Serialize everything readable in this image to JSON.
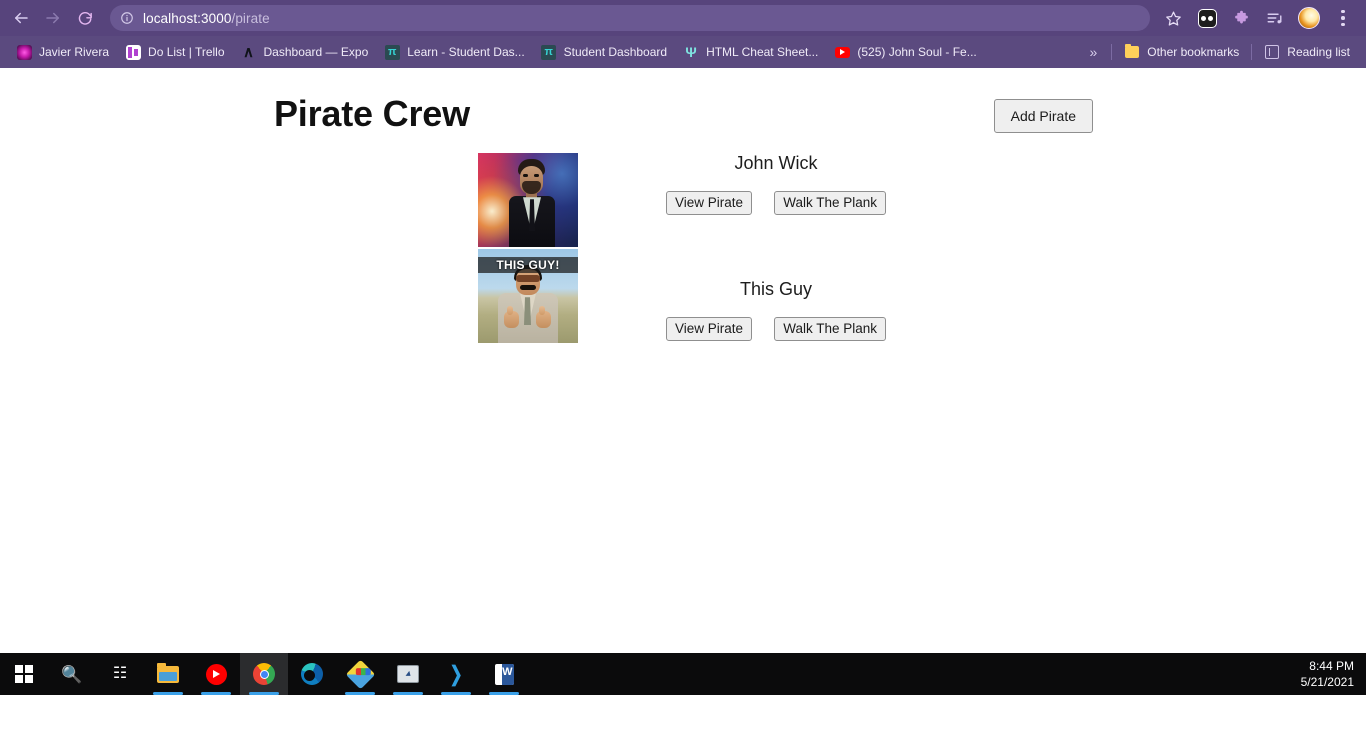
{
  "browser": {
    "back_icon": "back-arrow-icon",
    "forward_icon": "forward-arrow-icon",
    "reload_icon": "reload-icon",
    "omnibox": {
      "info_icon": "site-info-icon",
      "host": "localhost:3000",
      "path": "/pirate",
      "full_url": "localhost:3000/pirate"
    },
    "actions": [
      {
        "name": "bookmark-star-icon",
        "label": ""
      },
      {
        "name": "extension-robot-icon",
        "label": ""
      },
      {
        "name": "extensions-puzzle-icon",
        "label": ""
      },
      {
        "name": "reading-playlist-icon",
        "label": ""
      },
      {
        "name": "profile-avatar-icon",
        "label": ""
      },
      {
        "name": "chrome-menu-icon",
        "label": ""
      }
    ],
    "bookmarks": [
      {
        "label": "Javier Rivera",
        "icon": "javier-rivera-favicon"
      },
      {
        "label": "Do List | Trello",
        "icon": "trello-favicon"
      },
      {
        "label": "Dashboard — Expo",
        "icon": "expo-favicon"
      },
      {
        "label": "Learn - Student Das...",
        "icon": "learn-favicon"
      },
      {
        "label": "Student Dashboard",
        "icon": "student-dashboard-favicon"
      },
      {
        "label": "HTML Cheat Sheet...",
        "icon": "html-cheatsheet-favicon"
      },
      {
        "label": "(525) John Soul - Fe...",
        "icon": "youtube-favicon"
      }
    ],
    "overflow_label": "»",
    "other_bookmarks": {
      "label": "Other bookmarks",
      "icon": "folder-icon"
    },
    "reading_list": {
      "label": "Reading list",
      "icon": "reading-list-icon"
    }
  },
  "page": {
    "title": "Pirate Crew",
    "add_button": "Add Pirate",
    "pirates": [
      {
        "name": "John Wick",
        "image_alt": "john-wick-photo",
        "image_caption": "",
        "view_label": "View Pirate",
        "plank_label": "Walk The Plank"
      },
      {
        "name": "This Guy",
        "image_alt": "this-guy-photo",
        "image_caption": "THIS GUY!",
        "view_label": "View Pirate",
        "plank_label": "Walk The Plank"
      }
    ]
  },
  "taskbar": {
    "items": [
      {
        "name": "start-button",
        "icon": "windows-start-icon",
        "state": "idle"
      },
      {
        "name": "search-button",
        "icon": "search-icon",
        "state": "idle"
      },
      {
        "name": "task-view-button",
        "icon": "task-view-icon",
        "state": "idle"
      },
      {
        "name": "file-explorer-button",
        "icon": "file-explorer-icon",
        "state": "open"
      },
      {
        "name": "youtube-music-button",
        "icon": "youtube-music-icon",
        "state": "open"
      },
      {
        "name": "chrome-button",
        "icon": "chrome-icon",
        "state": "active"
      },
      {
        "name": "edge-button",
        "icon": "edge-icon",
        "state": "idle"
      },
      {
        "name": "paint-button",
        "icon": "paint-icon",
        "state": "open"
      },
      {
        "name": "monitor-button",
        "icon": "system-monitor-icon",
        "state": "open"
      },
      {
        "name": "vscode-button",
        "icon": "vscode-icon",
        "state": "open"
      },
      {
        "name": "word-button",
        "icon": "word-icon",
        "state": "open"
      }
    ],
    "clock": {
      "time": "8:44 PM",
      "date": "5/21/2021"
    }
  },
  "colors": {
    "chrome_toolbar": "#57447c",
    "chrome_bookmarks_bar": "#5b4a7f",
    "omnibox": "#6a5892",
    "page_background": "#ffffff",
    "button_face": "#efefef",
    "button_border": "#8f8f8f",
    "taskbar": "#0b0b0c"
  }
}
